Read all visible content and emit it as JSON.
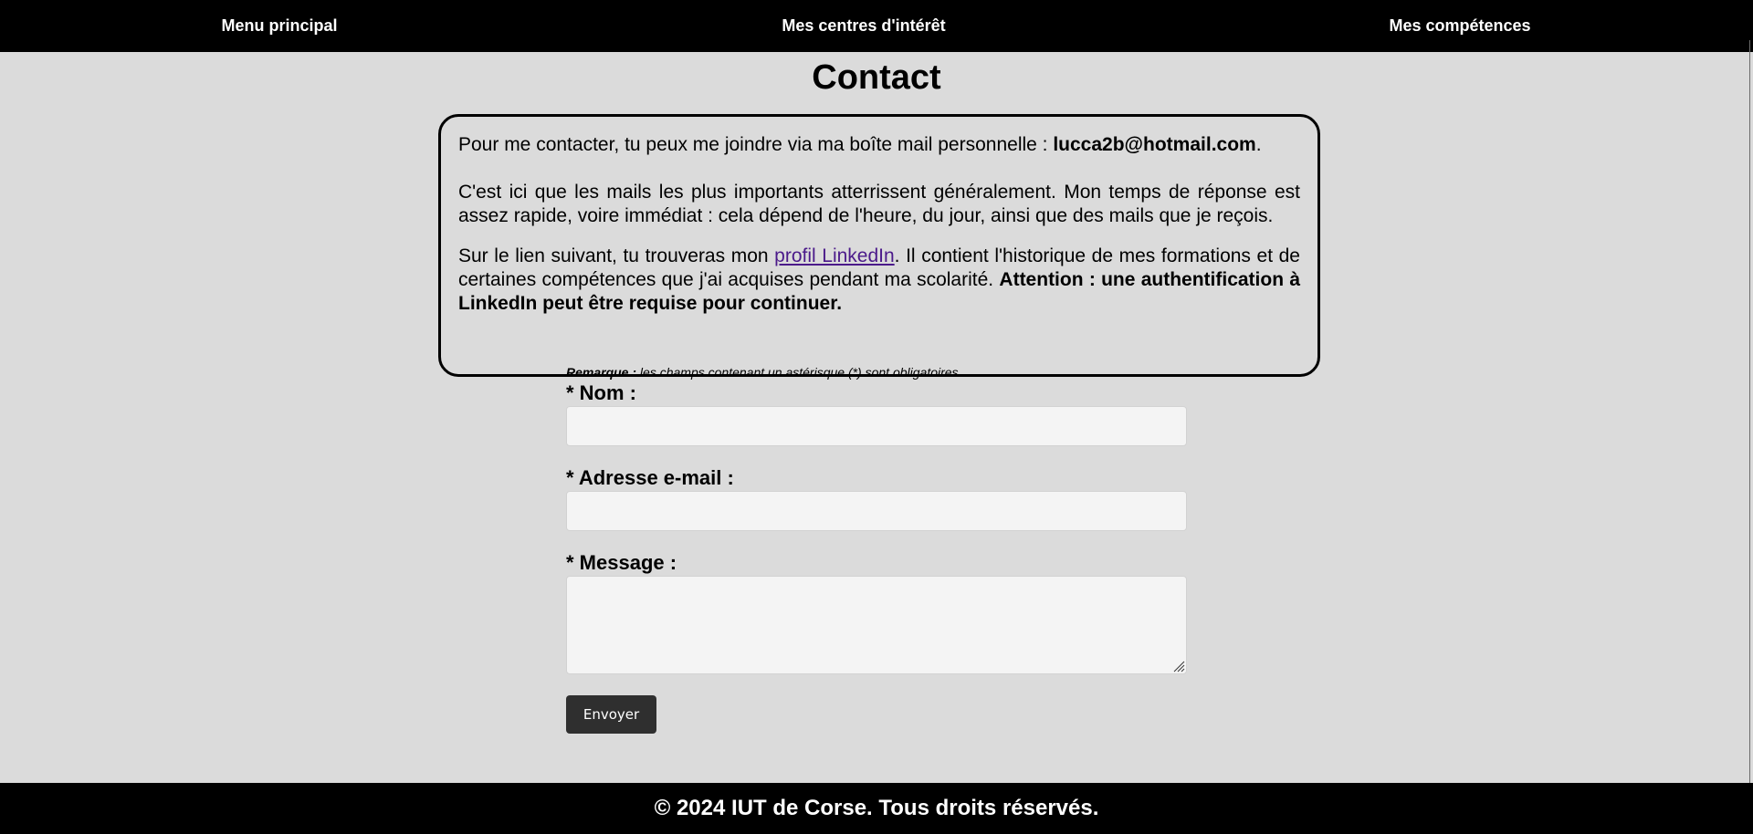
{
  "nav": {
    "items": [
      {
        "label": "Menu principal"
      },
      {
        "label": "Mes centres d'intérêt"
      },
      {
        "label": "Mes compétences"
      }
    ]
  },
  "page": {
    "title": "Contact"
  },
  "info": {
    "p1_text": "Pour me contacter, tu peux me joindre via ma boîte mail personnelle : ",
    "p1_email": "lucca2b@hotmail.com",
    "p1_end": ".",
    "p2_text": "C'est ici que les mails les plus importants atterrissent généralement. Mon temps de réponse est assez rapide, voire immédiat : cela dépend de l'heure, du jour, ainsi que des mails que je reçois.",
    "p3_before": "Sur le lien suivant, tu trouveras mon ",
    "p3_link": "profil LinkedIn",
    "p3_after": ". Il contient l'historique de mes formations et de certaines compétences que j'ai acquises pendant ma scolarité. ",
    "p3_bold": "Attention : une authentification à LinkedIn peut être requise pour continuer."
  },
  "form": {
    "remark_label": "Remarque :",
    "remark_text": " les champs contenant un astérisque (*) sont obligatoires.",
    "name_label": "* Nom :",
    "name_value": "",
    "email_label": "* Adresse e-mail :",
    "email_value": "",
    "message_label": "* Message :",
    "message_value": "",
    "submit_label": "Envoyer"
  },
  "footer": {
    "text": "© 2024 IUT de Corse. Tous droits réservés."
  },
  "colors": {
    "background": "#dbdbdb",
    "nav_bg": "#000000",
    "link": "#4b1a8a",
    "button_bg": "#2f2f2f",
    "input_bg": "#f4f4f4"
  }
}
